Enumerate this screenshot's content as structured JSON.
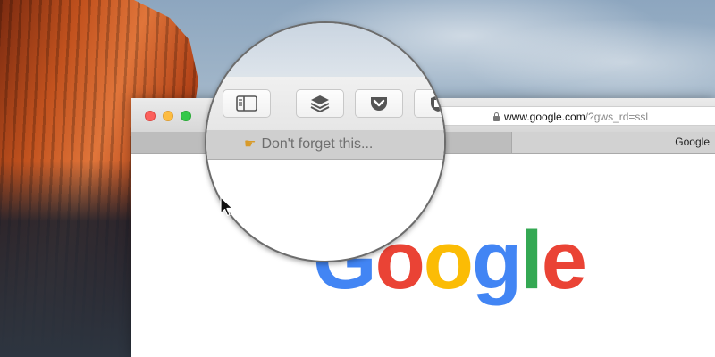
{
  "browser": {
    "url_domain": "www.google.com",
    "url_path": "/?gws_rd=ssl",
    "tab_title": "Google"
  },
  "bookmark": {
    "label": "Don't forget this...",
    "icon": "pointing-hand-icon"
  },
  "magnifier": {
    "buttons": [
      "sidebar-icon",
      "layers-icon",
      "pocket-icon",
      "shield-icon"
    ]
  },
  "page": {
    "logo_text": "Google"
  },
  "colors": {
    "close": "#fc605c",
    "minimize": "#fdbc40",
    "maximize": "#34c84a",
    "google_blue": "#4285f4",
    "google_red": "#ea4335",
    "google_yellow": "#fbbc05",
    "google_green": "#34a853"
  }
}
